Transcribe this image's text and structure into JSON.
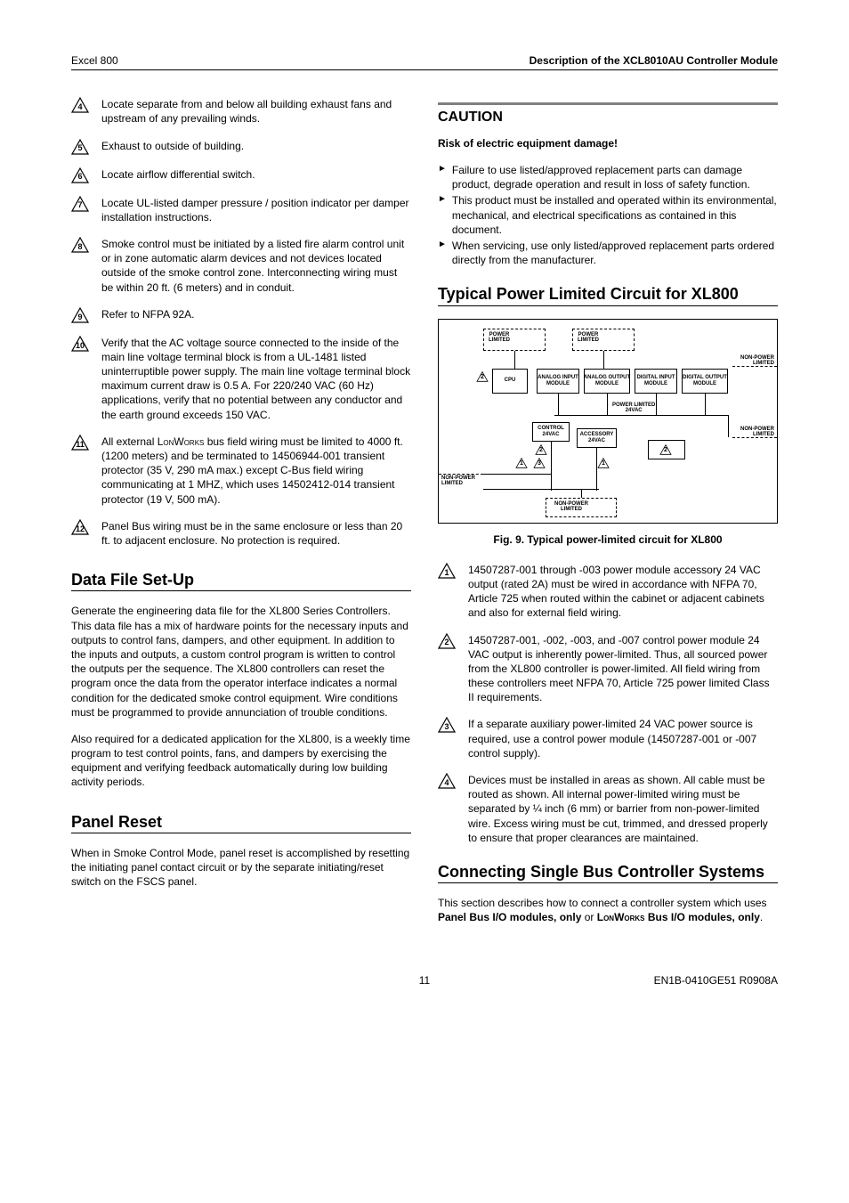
{
  "header": {
    "left": "Excel 800",
    "right": "Description of the XCL8010AU Controller Module"
  },
  "left_notes": [
    {
      "num": "4",
      "text": "Locate separate from and below all building exhaust fans and upstream of any prevailing winds."
    },
    {
      "num": "5",
      "text": "Exhaust to outside of building."
    },
    {
      "num": "6",
      "text": "Locate airflow differential switch."
    },
    {
      "num": "7",
      "text": "Locate UL-listed damper pressure / position indicator per damper installation instructions."
    },
    {
      "num": "8",
      "text": "Smoke control must be initiated by a listed fire alarm control unit or in zone automatic alarm devices and not devices located outside of the smoke control zone. Interconnecting wiring must be within 20 ft. (6 meters) and in conduit."
    },
    {
      "num": "9",
      "text": "Refer to NFPA 92A."
    },
    {
      "num": "10",
      "text": "Verify that the AC voltage source connected to the inside of the main line voltage terminal block is from a UL-1481 listed uninterruptible power supply. The main line voltage terminal block maximum current draw is 0.5 A. For 220/240 VAC (60 Hz) applications, verify that no potential between any conductor and the earth ground exceeds 150 VAC."
    },
    {
      "num": "11",
      "text": "All external LONWORKS bus field wiring must be limited to 4000 ft. (1200 meters) and be terminated to 14506944-001 transient protector (35 V, 290 mA max.) except C-Bus field wiring communicating at 1 MHZ, which uses 14502412-014 transient protector (19 V, 500 mA)."
    },
    {
      "num": "12",
      "text": "Panel Bus wiring must be in the same enclosure or less than 20 ft. to adjacent enclosure. No protection is required."
    }
  ],
  "datafile": {
    "heading": "Data File Set-Up",
    "p1": "Generate the engineering data file for the XL800 Series Controllers. This data file has a mix of hardware points for the necessary inputs and outputs to control fans, dampers, and other equipment. In addition to the inputs and outputs, a custom control program is written to control the outputs per the sequence. The XL800 controllers can reset the program once the data from the operator interface indicates a normal condition for the dedicated smoke control equipment. Wire conditions must be programmed to provide annunciation of trouble conditions.",
    "p2": "Also required for a dedicated application for the XL800, is a weekly time program to test control points, fans, and dampers by exercising the equipment and verifying feedback automatically during low building activity periods."
  },
  "panelreset": {
    "heading": "Panel Reset",
    "p": "When in Smoke Control Mode, panel reset is accomplished by resetting the initiating panel contact circuit or by the separate initiating/reset switch on the FSCS panel."
  },
  "caution": {
    "heading": "CAUTION",
    "sub": "Risk of electric equipment damage!",
    "items": [
      "Failure to use listed/approved replacement parts can damage product, degrade operation and result in loss of safety function.",
      "This product must be installed and operated within its environmental, mechanical, and electrical specifications as contained in this document.",
      "When servicing, use only listed/approved replacement parts ordered directly from the manufacturer."
    ]
  },
  "typical": {
    "heading": "Typical Power Limited Circuit for XL800",
    "caption": "Fig. 9. Typical power-limited circuit for XL800",
    "diagram": {
      "power_limited_1": "POWER\nLIMITED",
      "power_limited_2": "POWER\nLIMITED",
      "non_power_limited_1": "NON-POWER\nLIMITED",
      "non_power_limited_2": "NON-POWER\nLIMITED",
      "non_power_limited_3": "NON-POWER\nLIMITED",
      "non_power_limited_4": "NON-POWER\nLIMITED",
      "cpu": "CPU",
      "analog_input": "ANALOG INPUT\nMODULE",
      "analog_output": "ANALOG OUTPUT\nMODULE",
      "digital_input": "DIGITAL INPUT\nMODULE",
      "digital_output": "DIGITAL OUTPUT\nMODULE",
      "power_limited_24": "POWER LIMITED\n24VAC",
      "control_24": "CONTROL\n24VAC",
      "accessory_24": "ACCESSORY\n24VAC"
    }
  },
  "right_notes": [
    {
      "num": "1",
      "text": "14507287-001 through -003 power module accessory 24 VAC output (rated 2A) must be wired in accordance with NFPA 70, Article 725 when routed within the cabinet or adjacent cabinets and also for external field wiring."
    },
    {
      "num": "2",
      "text": "14507287-001, -002, -003, and -007 control power module 24 VAC output is inherently power-limited. Thus, all sourced power from the XL800 controller is power-limited. All field wiring from these controllers meet NFPA 70, Article 725 power limited Class II requirements."
    },
    {
      "num": "3",
      "text": "If a separate auxiliary power-limited 24 VAC power source is required, use a control power module (14507287-001 or -007 control supply)."
    },
    {
      "num": "4",
      "text": "Devices must be installed in areas as shown. All cable must be routed as shown. All internal power-limited wiring must be separated by ¼ inch (6 mm) or barrier from non-power-limited wire. Excess wiring must be cut, trimmed, and dressed properly to ensure that proper clearances are maintained."
    }
  ],
  "connecting": {
    "heading": "Connecting Single Bus Controller Systems",
    "pre": "This section describes how to connect a controller system which uses ",
    "bold1": "Panel Bus I/O modules, only",
    "mid": " or ",
    "bold2": "LONWORKS Bus I/O modules, only",
    "post": "."
  },
  "footer": {
    "page": "11",
    "doc": "EN1B-0410GE51 R0908A"
  }
}
